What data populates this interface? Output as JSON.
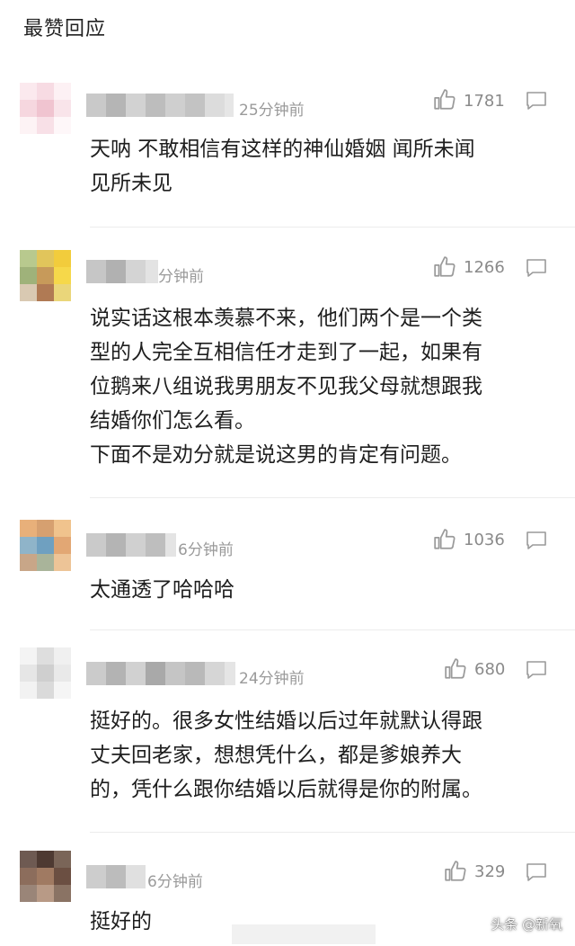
{
  "section_title": "最赞回应",
  "icons": {
    "like": "thumbs-up-icon",
    "reply": "comment-bubble-icon"
  },
  "comments": [
    {
      "time": "25分钟前",
      "likes": "1781",
      "lines": [
        "天呐 不敢相信有这样的神仙婚姻 闻所未闻",
        "见所未见"
      ]
    },
    {
      "time": "分钟前",
      "likes": "1266",
      "lines": [
        "说实话这根本羡慕不来，他们两个是一个类",
        "型的人完全互相信任才走到了一起，如果有",
        "位鹅来八组说我男朋友不见我父母就想跟我",
        "结婚你们怎么看。",
        "下面不是劝分就是说这男的肯定有问题。"
      ]
    },
    {
      "time": "6分钟前",
      "likes": "1036",
      "lines": [
        "太通透了哈哈哈"
      ]
    },
    {
      "time": "24分钟前",
      "likes": "680",
      "lines": [
        "挺好的。很多女性结婚以后过年就默认得跟",
        "丈夫回老家，想想凭什么，都是爹娘养大",
        "的，凭什么跟你结婚以后就得是你的附属。"
      ]
    },
    {
      "time": "6分钟前",
      "likes": "329",
      "lines": [
        "挺好的"
      ]
    }
  ],
  "watermark": "头条 @新氧"
}
